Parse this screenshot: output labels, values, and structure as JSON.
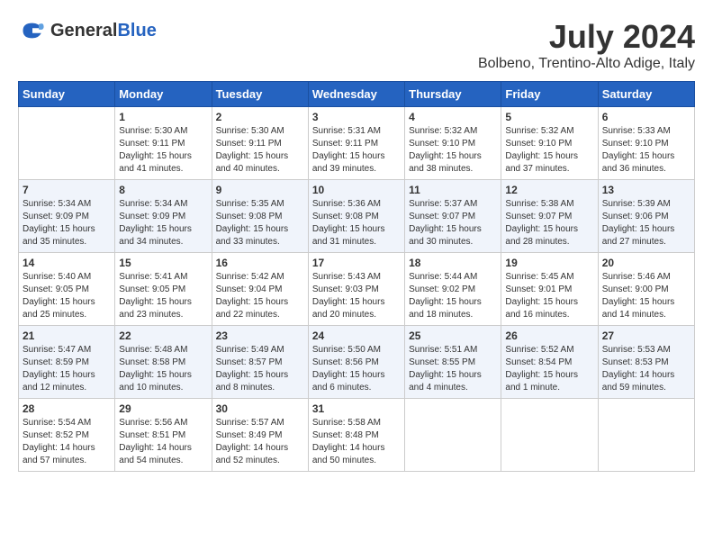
{
  "header": {
    "logo_line1": "General",
    "logo_line2": "Blue",
    "month": "July 2024",
    "location": "Bolbeno, Trentino-Alto Adige, Italy"
  },
  "weekdays": [
    "Sunday",
    "Monday",
    "Tuesday",
    "Wednesday",
    "Thursday",
    "Friday",
    "Saturday"
  ],
  "weeks": [
    [
      {
        "day": "",
        "sunrise": "",
        "sunset": "",
        "daylight": ""
      },
      {
        "day": "1",
        "sunrise": "Sunrise: 5:30 AM",
        "sunset": "Sunset: 9:11 PM",
        "daylight": "Daylight: 15 hours and 41 minutes."
      },
      {
        "day": "2",
        "sunrise": "Sunrise: 5:30 AM",
        "sunset": "Sunset: 9:11 PM",
        "daylight": "Daylight: 15 hours and 40 minutes."
      },
      {
        "day": "3",
        "sunrise": "Sunrise: 5:31 AM",
        "sunset": "Sunset: 9:11 PM",
        "daylight": "Daylight: 15 hours and 39 minutes."
      },
      {
        "day": "4",
        "sunrise": "Sunrise: 5:32 AM",
        "sunset": "Sunset: 9:10 PM",
        "daylight": "Daylight: 15 hours and 38 minutes."
      },
      {
        "day": "5",
        "sunrise": "Sunrise: 5:32 AM",
        "sunset": "Sunset: 9:10 PM",
        "daylight": "Daylight: 15 hours and 37 minutes."
      },
      {
        "day": "6",
        "sunrise": "Sunrise: 5:33 AM",
        "sunset": "Sunset: 9:10 PM",
        "daylight": "Daylight: 15 hours and 36 minutes."
      }
    ],
    [
      {
        "day": "7",
        "sunrise": "Sunrise: 5:34 AM",
        "sunset": "Sunset: 9:09 PM",
        "daylight": "Daylight: 15 hours and 35 minutes."
      },
      {
        "day": "8",
        "sunrise": "Sunrise: 5:34 AM",
        "sunset": "Sunset: 9:09 PM",
        "daylight": "Daylight: 15 hours and 34 minutes."
      },
      {
        "day": "9",
        "sunrise": "Sunrise: 5:35 AM",
        "sunset": "Sunset: 9:08 PM",
        "daylight": "Daylight: 15 hours and 33 minutes."
      },
      {
        "day": "10",
        "sunrise": "Sunrise: 5:36 AM",
        "sunset": "Sunset: 9:08 PM",
        "daylight": "Daylight: 15 hours and 31 minutes."
      },
      {
        "day": "11",
        "sunrise": "Sunrise: 5:37 AM",
        "sunset": "Sunset: 9:07 PM",
        "daylight": "Daylight: 15 hours and 30 minutes."
      },
      {
        "day": "12",
        "sunrise": "Sunrise: 5:38 AM",
        "sunset": "Sunset: 9:07 PM",
        "daylight": "Daylight: 15 hours and 28 minutes."
      },
      {
        "day": "13",
        "sunrise": "Sunrise: 5:39 AM",
        "sunset": "Sunset: 9:06 PM",
        "daylight": "Daylight: 15 hours and 27 minutes."
      }
    ],
    [
      {
        "day": "14",
        "sunrise": "Sunrise: 5:40 AM",
        "sunset": "Sunset: 9:05 PM",
        "daylight": "Daylight: 15 hours and 25 minutes."
      },
      {
        "day": "15",
        "sunrise": "Sunrise: 5:41 AM",
        "sunset": "Sunset: 9:05 PM",
        "daylight": "Daylight: 15 hours and 23 minutes."
      },
      {
        "day": "16",
        "sunrise": "Sunrise: 5:42 AM",
        "sunset": "Sunset: 9:04 PM",
        "daylight": "Daylight: 15 hours and 22 minutes."
      },
      {
        "day": "17",
        "sunrise": "Sunrise: 5:43 AM",
        "sunset": "Sunset: 9:03 PM",
        "daylight": "Daylight: 15 hours and 20 minutes."
      },
      {
        "day": "18",
        "sunrise": "Sunrise: 5:44 AM",
        "sunset": "Sunset: 9:02 PM",
        "daylight": "Daylight: 15 hours and 18 minutes."
      },
      {
        "day": "19",
        "sunrise": "Sunrise: 5:45 AM",
        "sunset": "Sunset: 9:01 PM",
        "daylight": "Daylight: 15 hours and 16 minutes."
      },
      {
        "day": "20",
        "sunrise": "Sunrise: 5:46 AM",
        "sunset": "Sunset: 9:00 PM",
        "daylight": "Daylight: 15 hours and 14 minutes."
      }
    ],
    [
      {
        "day": "21",
        "sunrise": "Sunrise: 5:47 AM",
        "sunset": "Sunset: 8:59 PM",
        "daylight": "Daylight: 15 hours and 12 minutes."
      },
      {
        "day": "22",
        "sunrise": "Sunrise: 5:48 AM",
        "sunset": "Sunset: 8:58 PM",
        "daylight": "Daylight: 15 hours and 10 minutes."
      },
      {
        "day": "23",
        "sunrise": "Sunrise: 5:49 AM",
        "sunset": "Sunset: 8:57 PM",
        "daylight": "Daylight: 15 hours and 8 minutes."
      },
      {
        "day": "24",
        "sunrise": "Sunrise: 5:50 AM",
        "sunset": "Sunset: 8:56 PM",
        "daylight": "Daylight: 15 hours and 6 minutes."
      },
      {
        "day": "25",
        "sunrise": "Sunrise: 5:51 AM",
        "sunset": "Sunset: 8:55 PM",
        "daylight": "Daylight: 15 hours and 4 minutes."
      },
      {
        "day": "26",
        "sunrise": "Sunrise: 5:52 AM",
        "sunset": "Sunset: 8:54 PM",
        "daylight": "Daylight: 15 hours and 1 minute."
      },
      {
        "day": "27",
        "sunrise": "Sunrise: 5:53 AM",
        "sunset": "Sunset: 8:53 PM",
        "daylight": "Daylight: 14 hours and 59 minutes."
      }
    ],
    [
      {
        "day": "28",
        "sunrise": "Sunrise: 5:54 AM",
        "sunset": "Sunset: 8:52 PM",
        "daylight": "Daylight: 14 hours and 57 minutes."
      },
      {
        "day": "29",
        "sunrise": "Sunrise: 5:56 AM",
        "sunset": "Sunset: 8:51 PM",
        "daylight": "Daylight: 14 hours and 54 minutes."
      },
      {
        "day": "30",
        "sunrise": "Sunrise: 5:57 AM",
        "sunset": "Sunset: 8:49 PM",
        "daylight": "Daylight: 14 hours and 52 minutes."
      },
      {
        "day": "31",
        "sunrise": "Sunrise: 5:58 AM",
        "sunset": "Sunset: 8:48 PM",
        "daylight": "Daylight: 14 hours and 50 minutes."
      },
      {
        "day": "",
        "sunrise": "",
        "sunset": "",
        "daylight": ""
      },
      {
        "day": "",
        "sunrise": "",
        "sunset": "",
        "daylight": ""
      },
      {
        "day": "",
        "sunrise": "",
        "sunset": "",
        "daylight": ""
      }
    ]
  ]
}
